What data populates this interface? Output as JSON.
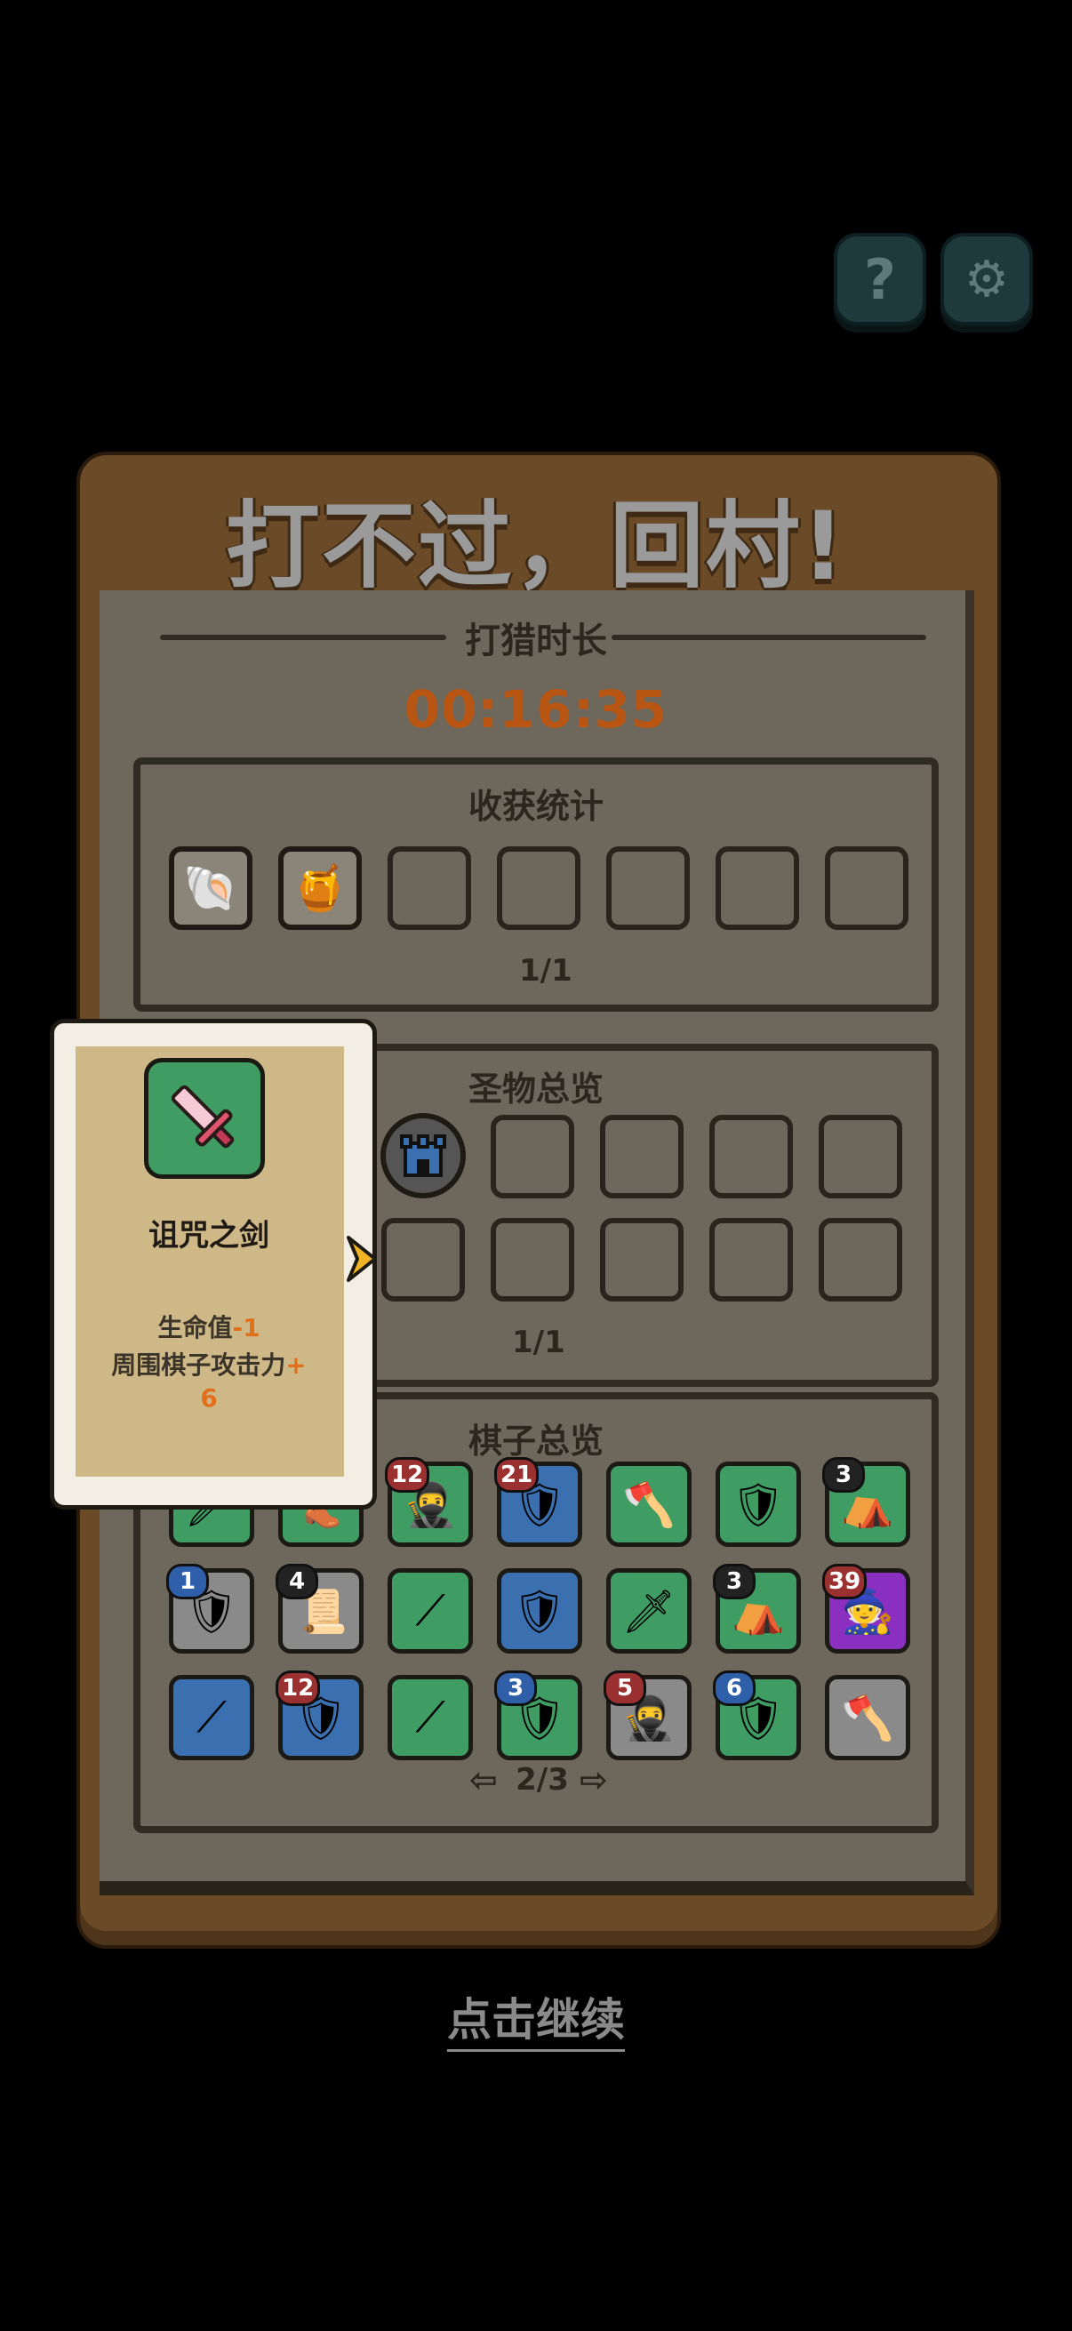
{
  "title": "打不过，回村!",
  "hunt": {
    "label": "打猎时长",
    "time": "00:16:35"
  },
  "harvest": {
    "title": "收获统计",
    "count": "1/1",
    "items": [
      {
        "icon": "shell-icon",
        "glyph": "🐚"
      },
      {
        "icon": "honey-jar-icon",
        "glyph": "🍯"
      },
      {
        "icon": "empty"
      },
      {
        "icon": "empty"
      },
      {
        "icon": "empty"
      },
      {
        "icon": "empty"
      },
      {
        "icon": "empty"
      }
    ]
  },
  "relics": {
    "title": "圣物总览",
    "count": "1/1",
    "relic_icon": "castle-icon"
  },
  "pieces": {
    "title": "棋子总览",
    "page": "2/3",
    "rows": [
      [
        {
          "icon": "sword-icon",
          "color": "#3f9c62",
          "badge": ""
        },
        {
          "icon": "boot-icon",
          "color": "#3f9c62",
          "badge": ""
        },
        {
          "icon": "ninja-icon",
          "color": "#3f9c62",
          "badge": "12",
          "badge_color": "#9a3030"
        },
        {
          "icon": "knight-icon",
          "color": "#3a6fb0",
          "badge": "21",
          "badge_color": "#9a3030"
        },
        {
          "icon": "axe-icon",
          "color": "#3f9c62",
          "badge": ""
        },
        {
          "icon": "shield-icon",
          "color": "#3f9c62",
          "badge": ""
        },
        {
          "icon": "tent-icon",
          "color": "#3f9c62",
          "badge": "3",
          "badge_color": "#222"
        }
      ],
      [
        {
          "icon": "shield-icon",
          "color": "#8a8a8a",
          "badge": "1",
          "badge_color": "#2f5fa8"
        },
        {
          "icon": "scroll-icon",
          "color": "#8a8a8a",
          "badge": "4",
          "badge_color": "#222"
        },
        {
          "icon": "spear-icon",
          "color": "#3f9c62",
          "badge": ""
        },
        {
          "icon": "shield-icon",
          "color": "#3a6fb0",
          "badge": ""
        },
        {
          "icon": "sword-icon",
          "color": "#3f9c62",
          "badge": ""
        },
        {
          "icon": "tent-icon",
          "color": "#3f9c62",
          "badge": "3",
          "badge_color": "#222"
        },
        {
          "icon": "mage-icon",
          "color": "#8a2fbf",
          "badge": "39",
          "badge_color": "#9a3030"
        }
      ],
      [
        {
          "icon": "spear-icon",
          "color": "#3a6fb0",
          "badge": ""
        },
        {
          "icon": "knight-icon",
          "color": "#3a6fb0",
          "badge": "12",
          "badge_color": "#9a3030"
        },
        {
          "icon": "spear-icon",
          "color": "#3f9c62",
          "badge": ""
        },
        {
          "icon": "shield-icon",
          "color": "#3f9c62",
          "badge": "3",
          "badge_color": "#2f5fa8"
        },
        {
          "icon": "ninja-icon",
          "color": "#8a8a8a",
          "badge": "5",
          "badge_color": "#9a3030"
        },
        {
          "icon": "shield-icon",
          "color": "#3f9c62",
          "badge": "6",
          "badge_color": "#2f5fa8"
        },
        {
          "icon": "axe-icon",
          "color": "#8a8a8a",
          "badge": ""
        }
      ]
    ]
  },
  "tooltip": {
    "name": "诅咒之剑",
    "line1_label": "生命值",
    "line1_value": "-1",
    "line2_label": "周围棋子攻击力",
    "line2_value": "+",
    "line3_value": "6"
  },
  "continue_label": "点击继续",
  "buttons": {
    "help": "?",
    "settings": "⚙"
  }
}
